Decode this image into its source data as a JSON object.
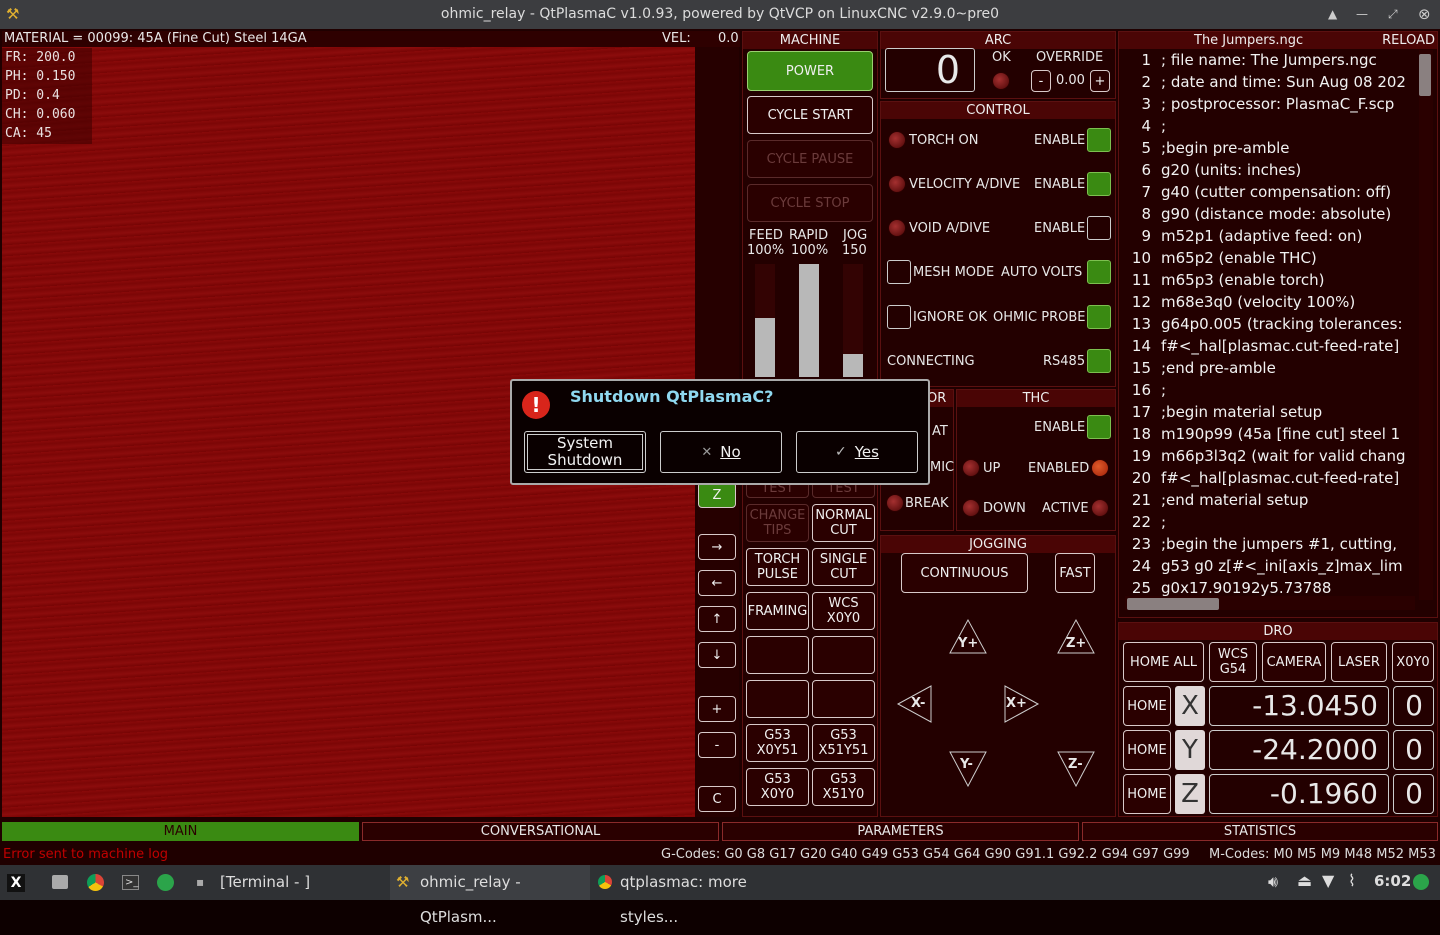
{
  "window": {
    "title": "ohmic_relay - QtPlasmaC v1.0.93, powered by QtVCP on LinuxCNC v2.9.0~pre0"
  },
  "preview": {
    "material": "MATERIAL =  00099: 45A (Fine Cut) Steel 14GA",
    "vel_label": "VEL:",
    "vel_value": "0.0",
    "params": [
      "FR: 200.0",
      "PH: 0.150",
      "PD: 0.4",
      "CH: 0.060",
      "CA: 45"
    ],
    "side_buttons": [
      "Z",
      "→",
      "←",
      "↑",
      "↓",
      "+",
      "-",
      "C"
    ]
  },
  "machine": {
    "title": "MACHINE",
    "power": "POWER",
    "cycle_start": "CYCLE START",
    "cycle_pause": "CYCLE PAUSE",
    "cycle_stop": "CYCLE STOP",
    "feed_label": "FEED",
    "feed_value": "100%",
    "rapid_label": "RAPID",
    "rapid_value": "100%",
    "jog_label": "JOG",
    "jog_value": "150",
    "feed_level": 0.52,
    "rapid_level": 1.0,
    "jog_level": 0.2,
    "buttons": [
      [
        "TEST",
        "TEST"
      ],
      [
        "CHANGE TIPS",
        "NORMAL CUT"
      ],
      [
        "TORCH PULSE",
        "SINGLE CUT"
      ],
      [
        "FRAMING",
        "WCS X0Y0"
      ],
      [
        "",
        ""
      ],
      [
        "",
        ""
      ],
      [
        "G53 X0Y51",
        "G53 X51Y51"
      ],
      [
        "G53 X0Y0",
        "G53 X51Y0"
      ]
    ]
  },
  "arc": {
    "title": "ARC",
    "value": "0",
    "ok_label": "OK",
    "override_label": "OVERRIDE",
    "minus": "-",
    "plus": "+",
    "override_value": "0.00"
  },
  "control": {
    "title": "CONTROL",
    "rows": [
      {
        "label": "TORCH ON",
        "right": "ENABLE"
      },
      {
        "label": "VELOCITY A/DIVE",
        "right": "ENABLE"
      },
      {
        "label": "VOID A/DIVE",
        "right": "ENABLE"
      },
      {
        "label": "MESH MODE",
        "right": "AUTO VOLTS"
      },
      {
        "label": "IGNORE OK",
        "right": "OHMIC PROBE"
      },
      {
        "label": "CONNECTING",
        "right": "RS485"
      }
    ]
  },
  "sensor": {
    "title": "OR",
    "at": "AT",
    "mic": "MIC",
    "break": "BREAK"
  },
  "thc": {
    "title": "THC",
    "enable": "ENABLE",
    "up": "UP",
    "enabled": "ENABLED",
    "down": "DOWN",
    "active": "ACTIVE"
  },
  "jogging": {
    "title": "JOGGING",
    "continuous": "CONTINUOUS",
    "fast": "FAST",
    "yplus": "Y+",
    "zplus": "Z+",
    "xminus": "X-",
    "xplus": "X+",
    "yminus": "Y-",
    "zminus": "Z-"
  },
  "gcode": {
    "title": "The Jumpers.ngc",
    "reload": "RELOAD",
    "lines": [
      ";     file name: The Jumpers.ngc",
      "; date and time: Sun Aug 08 202",
      "; postprocessor: PlasmaC_F.scp",
      ";",
      ";begin pre-amble",
      "g20 (units: inches)",
      "g40 (cutter compensation: off)",
      "g90 (distance mode: absolute)",
      "m52p1 (adaptive feed: on)",
      "m65p2 (enable THC)",
      "m65p3 (enable torch)",
      "m68e3q0 (velocity 100%)",
      "g64p0.005 (tracking tolerances:",
      "f#<_hal[plasmac.cut-feed-rate]",
      ";end pre-amble",
      ";",
      ";begin material setup",
      "m190p99 (45a [fine cut] steel 1",
      "m66p3l3q2 (wait for valid chang",
      "f#<_hal[plasmac.cut-feed-rate]",
      ";end material setup",
      ";",
      ";begin the jumpers #1, cutting,",
      "g53 g0 z[#<_ini[axis_z]max_lim",
      "g0x17.90192y5.73788"
    ]
  },
  "dro": {
    "title": "DRO",
    "home_all": "HOME ALL",
    "wcs": "WCS G54",
    "camera": "CAMERA",
    "laser": "LASER",
    "x0y0": "X0Y0",
    "home": "HOME",
    "axes": [
      {
        "name": "X",
        "value": "-13.0450",
        "zero": "0"
      },
      {
        "name": "Y",
        "value": "-24.2000",
        "zero": "0"
      },
      {
        "name": "Z",
        "value": "-0.1960",
        "zero": "0"
      }
    ]
  },
  "tabs": [
    "MAIN",
    "CONVERSATIONAL",
    "PARAMETERS",
    "STATISTICS"
  ],
  "status": {
    "error": "Error sent to machine log",
    "gcodes": "G-Codes: G0 G8 G17 G20 G40 G49 G53 G54 G64 G90 G91.1 G92.2 G94 G97 G99",
    "mcodes": "M-Codes: M0 M5 M9 M48 M52 M53"
  },
  "dialog": {
    "title": "Shutdown QtPlasmaC?",
    "system_shutdown": "System Shutdown",
    "no": "No",
    "yes": "Yes"
  },
  "taskbar": {
    "items": [
      "[Terminal - ]",
      "ohmic_relay - QtPlasm...",
      "qtplasmac: more styles..."
    ],
    "clock": "6:02"
  }
}
